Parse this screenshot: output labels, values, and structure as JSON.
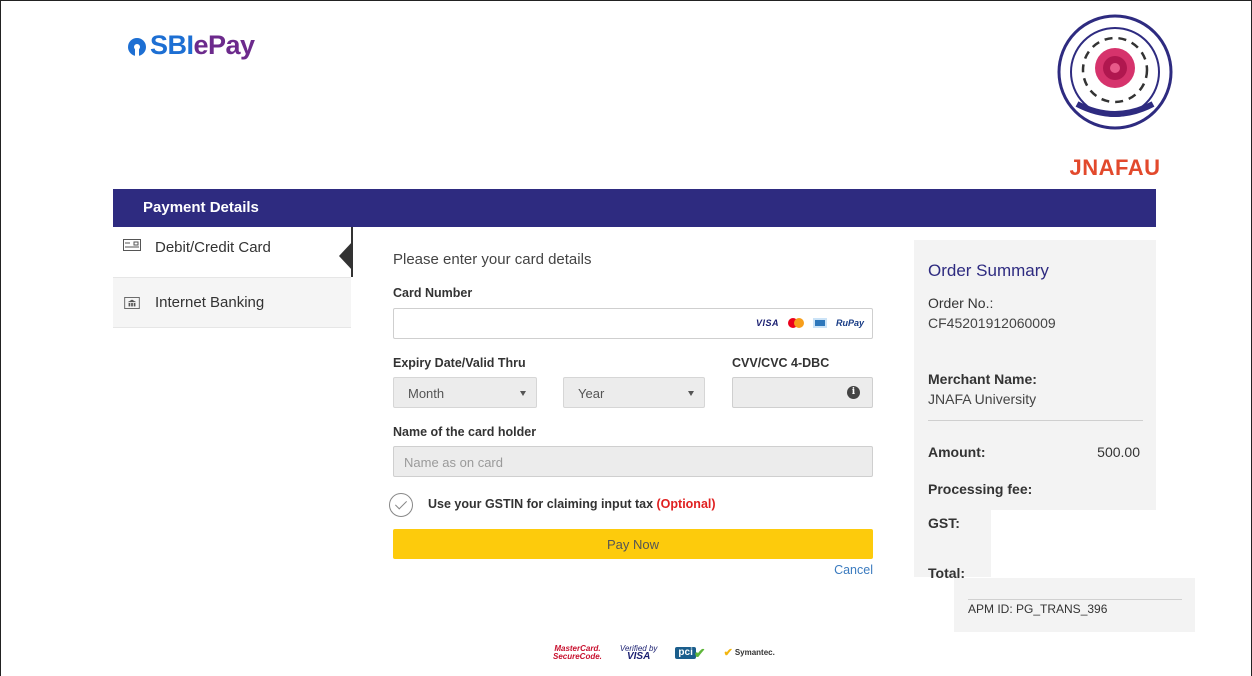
{
  "brand": {
    "name_part1": "SBI",
    "name_part2": "ePay"
  },
  "merchant_logo": {
    "name": "JNAFAU"
  },
  "header": {
    "title": "Payment Details"
  },
  "sidebar": {
    "items": [
      {
        "label": "Debit/Credit Card",
        "active": true
      },
      {
        "label": "Internet Banking",
        "active": false
      }
    ]
  },
  "form": {
    "intro": "Please enter your card details",
    "card_number_label": "Card Number",
    "card_number_value": "",
    "card_brands": [
      "VISA",
      "MasterCard",
      "Amex",
      "RuPay"
    ],
    "expiry_label": "Expiry Date/Valid Thru",
    "month_selected": "Month",
    "year_selected": "Year",
    "cvv_label": "CVV/CVC 4-DBC",
    "holder_label": "Name of the card holder",
    "holder_placeholder": "Name as on card",
    "gst_text": "Use your GSTIN for claiming input tax",
    "gst_optional": "(Optional)",
    "pay_label": "Pay Now",
    "cancel_label": "Cancel"
  },
  "summary": {
    "title": "Order Summary",
    "order_no_label": "Order No.:",
    "order_no": "CF45201912060009",
    "merchant_label": "Merchant Name:",
    "merchant_name": "JNAFA University",
    "amount_label": "Amount:",
    "amount": "500.00",
    "fee_label": "Processing fee:",
    "gst_label": "GST:",
    "total_label": "Total:",
    "apm_id": "APM ID: PG_TRANS_396"
  },
  "footer_badges": {
    "mastercard_l1": "MasterCard.",
    "mastercard_l2": "SecureCode.",
    "visa_l1": "Verified by",
    "visa_l2": "VISA",
    "pci": "pci",
    "symantec": "Symantec."
  },
  "colors": {
    "header_bar": "#2e2b80",
    "pay_button": "#fdcb0c",
    "accent_link": "#3b7bbf",
    "optional": "#e02020"
  }
}
